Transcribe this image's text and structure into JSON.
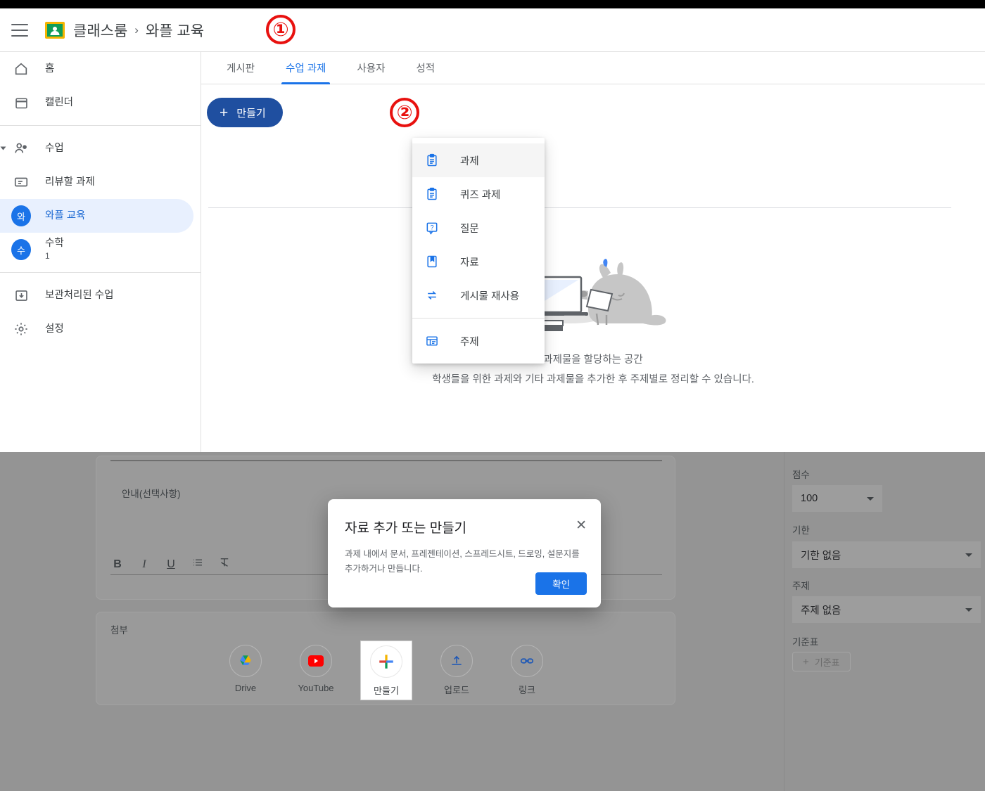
{
  "header": {
    "menu_icon": "hamburger-icon",
    "logo": "google-classroom-logo",
    "app_name": "클래스룸",
    "separator": "›",
    "class_name": "와플 교육"
  },
  "markers": {
    "one": "①",
    "two": "②"
  },
  "sidebar": {
    "items": [
      {
        "label": "홈",
        "icon": "home-icon"
      },
      {
        "label": "캘린더",
        "icon": "calendar-icon"
      }
    ],
    "section": {
      "label": "수업",
      "icon": "people-icon"
    },
    "classes": [
      {
        "label": "리뷰할 과제",
        "icon": "review-icon"
      },
      {
        "label": "와플 교육",
        "avatar": "와",
        "selected": true
      },
      {
        "label": "수학",
        "sub": "1",
        "avatar": "수"
      }
    ],
    "footer": [
      {
        "label": "보관처리된 수업",
        "icon": "archive-icon"
      },
      {
        "label": "설정",
        "icon": "gear-icon"
      }
    ]
  },
  "main": {
    "tabs": [
      {
        "label": "게시판",
        "active": false
      },
      {
        "label": "수업 과제",
        "active": true
      },
      {
        "label": "사용자",
        "active": false
      },
      {
        "label": "성적",
        "active": false
      }
    ],
    "create_button": {
      "label": "만들기",
      "icon": "plus-icon"
    },
    "create_menu": [
      {
        "label": "과제",
        "icon": "assignment-icon",
        "hover": true
      },
      {
        "label": "퀴즈 과제",
        "icon": "quiz-assignment-icon"
      },
      {
        "label": "질문",
        "icon": "question-icon"
      },
      {
        "label": "자료",
        "icon": "material-icon"
      },
      {
        "label": "게시물 재사용",
        "icon": "reuse-post-icon"
      },
      {
        "label": "주제",
        "icon": "topic-icon"
      }
    ],
    "empty_state": {
      "illustration": "wolf-with-laptop-illustration",
      "title": "과제물을 할당하는 공간",
      "description": "학생들을 위한 과제와 기타 과제물을 추가한 후 주제별로 정리할 수 있습니다."
    }
  },
  "assignment_form": {
    "description_placeholder": "안내(선택사항)",
    "format_tools": [
      {
        "label": "B",
        "icon": "bold-icon"
      },
      {
        "label": "I",
        "icon": "italic-icon"
      },
      {
        "label": "U",
        "icon": "underline-icon"
      },
      {
        "label": "≔",
        "icon": "bulleted-list-icon"
      },
      {
        "label": "T̶",
        "icon": "clear-formatting-icon"
      }
    ],
    "attach_label": "첨부",
    "attachments": [
      {
        "label": "Drive",
        "icon": "google-drive-icon"
      },
      {
        "label": "YouTube",
        "icon": "youtube-icon"
      },
      {
        "label": "만들기",
        "icon": "create-plus-icon",
        "highlight": true
      },
      {
        "label": "업로드",
        "icon": "upload-icon"
      },
      {
        "label": "링크",
        "icon": "link-icon"
      }
    ]
  },
  "options_panel": {
    "score": {
      "label": "점수",
      "value": "100"
    },
    "due": {
      "label": "기한",
      "value": "기한 없음"
    },
    "topic": {
      "label": "주제",
      "value": "주제 없음"
    },
    "rubric": {
      "label": "기준표",
      "button": "기준표",
      "button_icon": "plus-icon"
    }
  },
  "dialog": {
    "title": "자료 추가 또는 만들기",
    "close_icon": "close-icon",
    "body": "과제 내에서 문서, 프레젠테이션, 스프레드시트, 드로잉, 설문지를 추가하거나 만듭니다.",
    "ok_label": "확인"
  },
  "colors": {
    "accent_blue": "#1a73e8",
    "create_button_blue": "#1f4fa0",
    "marker_red": "#e8110f",
    "selected_bg": "#e8f0fe"
  }
}
